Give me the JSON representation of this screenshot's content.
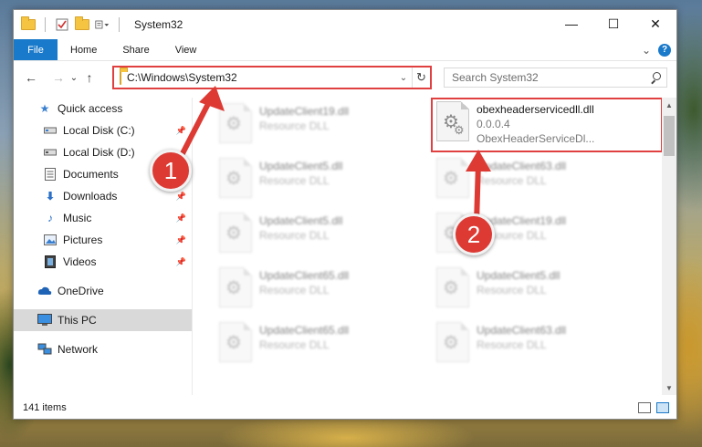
{
  "window": {
    "title": "System32",
    "minimize": "—",
    "maximize": "☐",
    "close": "✕"
  },
  "ribbon": {
    "tabs": [
      "File",
      "Home",
      "Share",
      "View"
    ],
    "expand": "⌄",
    "help": "?"
  },
  "nav": {
    "back": "←",
    "forward": "→",
    "recent": "⌄",
    "up": "↑",
    "address": "C:\\Windows\\System32",
    "address_drop": "⌄",
    "refresh": "↻",
    "search_placeholder": "Search System32"
  },
  "sidebar": {
    "items": [
      {
        "label": "Quick access",
        "icon": "star-icon",
        "color": "#3a7fd0"
      },
      {
        "label": "Local Disk (C:)",
        "icon": "drive-icon",
        "pinned": true
      },
      {
        "label": "Local Disk (D:)",
        "icon": "drive-icon",
        "pinned": false
      },
      {
        "label": "Documents",
        "icon": "documents-icon",
        "pinned": true
      },
      {
        "label": "Downloads",
        "icon": "download-icon",
        "pinned": true
      },
      {
        "label": "Music",
        "icon": "music-icon",
        "pinned": true
      },
      {
        "label": "Pictures",
        "icon": "pictures-icon",
        "pinned": true
      },
      {
        "label": "Videos",
        "icon": "videos-icon",
        "pinned": true
      },
      {
        "label": "OneDrive",
        "icon": "cloud-icon"
      },
      {
        "label": "This PC",
        "icon": "pc-icon",
        "selected": true
      },
      {
        "label": "Network",
        "icon": "network-icon"
      }
    ]
  },
  "files": {
    "highlighted": {
      "name": "obexheaderservicedll.dll",
      "version": "0.0.0.4",
      "description": "ObexHeaderServiceDl..."
    },
    "left_column": [
      {
        "name": "UpdateClient19.dll",
        "type": "Resource DLL"
      },
      {
        "name": "UpdateClient5.dll",
        "type": "Resource DLL"
      },
      {
        "name": "UpdateClient5.dll",
        "type": "Resource DLL"
      },
      {
        "name": "UpdateClient65.dll",
        "type": "Resource DLL"
      },
      {
        "name": "UpdateClient65.dll",
        "type": "Resource DLL"
      }
    ],
    "right_column": [
      {
        "name": "UpdateClient63.dll",
        "type": "Resource DLL"
      },
      {
        "name": "UpdateClient19.dll",
        "type": "Resource DLL"
      },
      {
        "name": "UpdateClient5.dll",
        "type": "Resource DLL"
      },
      {
        "name": "UpdateClient63.dll",
        "type": "Resource DLL"
      }
    ]
  },
  "status": {
    "items": "141 items"
  },
  "annotations": {
    "step1": "1",
    "step2": "2",
    "color": "#dd3a34"
  }
}
